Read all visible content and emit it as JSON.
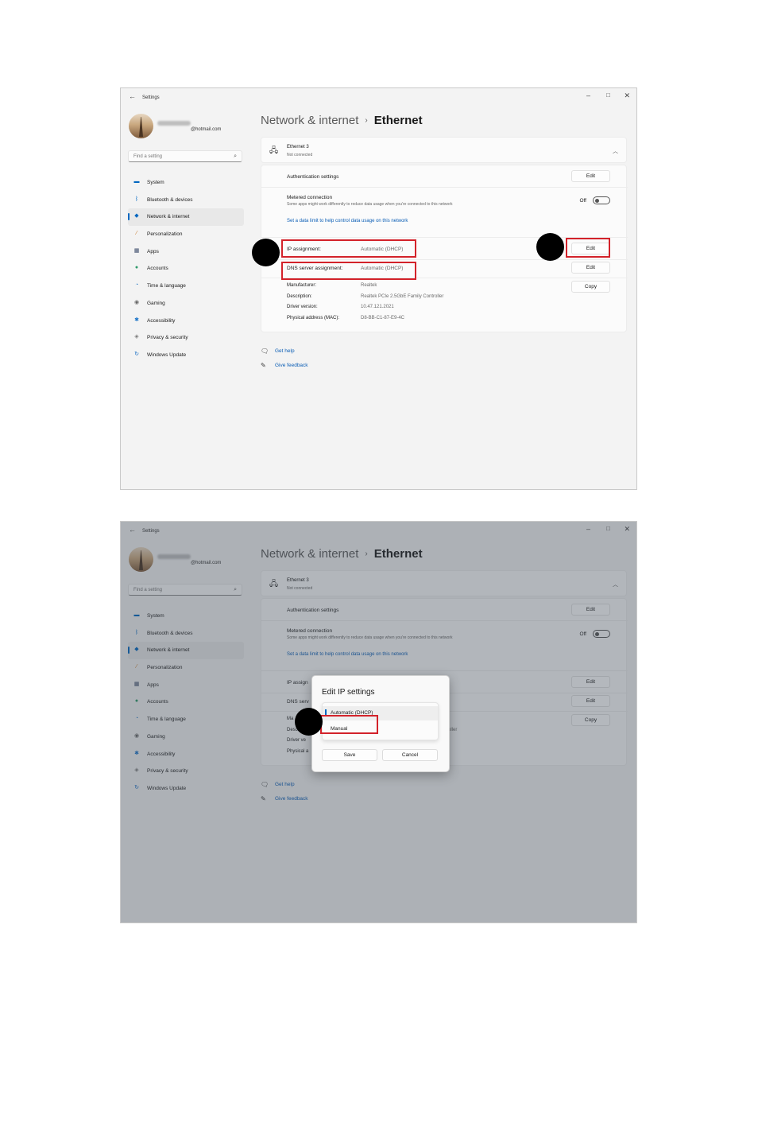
{
  "app_title": "Settings",
  "user": {
    "email_suffix": "@hotmail.com"
  },
  "search": {
    "placeholder": "Find a setting"
  },
  "nav_items": [
    {
      "label": "System",
      "icon": "monitor-icon",
      "color": "#0067c0"
    },
    {
      "label": "Bluetooth & devices",
      "icon": "bluetooth-icon",
      "color": "#0067c0"
    },
    {
      "label": "Network & internet",
      "icon": "wifi-icon",
      "color": "#0067c0"
    },
    {
      "label": "Personalization",
      "icon": "brush-icon",
      "color": "#c87a2b"
    },
    {
      "label": "Apps",
      "icon": "apps-icon",
      "color": "#3a4a6a"
    },
    {
      "label": "Accounts",
      "icon": "person-icon",
      "color": "#2e9a6a"
    },
    {
      "label": "Time & language",
      "icon": "globe-clock-icon",
      "color": "#2a7bc4"
    },
    {
      "label": "Gaming",
      "icon": "gamepad-icon",
      "color": "#666666"
    },
    {
      "label": "Accessibility",
      "icon": "accessibility-icon",
      "color": "#1a73c8"
    },
    {
      "label": "Privacy & security",
      "icon": "shield-icon",
      "color": "#7a7a7a"
    },
    {
      "label": "Windows Update",
      "icon": "update-icon",
      "color": "#1a6fc4"
    }
  ],
  "breadcrumb": {
    "parent": "Network & internet",
    "separator": "›",
    "current": "Ethernet"
  },
  "ethernet": {
    "name": "Ethernet 3",
    "status": "Not connected",
    "auth_label": "Authentication settings",
    "metered_label": "Metered connection",
    "metered_desc": "Some apps might work differently to reduce data usage when you're connected to this network",
    "metered_toggle": "Off",
    "data_limit_link": "Set a data limit to help control data usage on this network",
    "ip_label": "IP assignment:",
    "ip_value": "Automatic (DHCP)",
    "dns_label": "DNS server assignment:",
    "dns_value": "Automatic (DHCP)",
    "details": [
      {
        "key": "Manufacturer:",
        "value": "Realtek"
      },
      {
        "key": "Description:",
        "value": "Realtek PCIe 2.5GbE Family Controller"
      },
      {
        "key": "Driver version:",
        "value": "10.47.121.2021"
      },
      {
        "key": "Physical address (MAC):",
        "value": "D8-BB-C1-87-E9-4C"
      }
    ],
    "edit_label": "Edit",
    "copy_label": "Copy"
  },
  "help": {
    "get_help": "Get help",
    "give_feedback": "Give feedback"
  },
  "dialog": {
    "title": "Edit IP settings",
    "options": [
      "Automatic (DHCP)",
      "Manual"
    ],
    "selected": "Automatic (DHCP)",
    "save": "Save",
    "cancel": "Cancel"
  },
  "overlap_text": {
    "ip_partial": "IP assign",
    "dns_partial": "DNS serv",
    "man_partial": "Ma",
    "desc_partial": "Descri",
    "drv_partial": "Driver ve",
    "phys_partial": "Physical a",
    "ctrl_partial": "oller"
  },
  "highlight_color": "#d3222a"
}
